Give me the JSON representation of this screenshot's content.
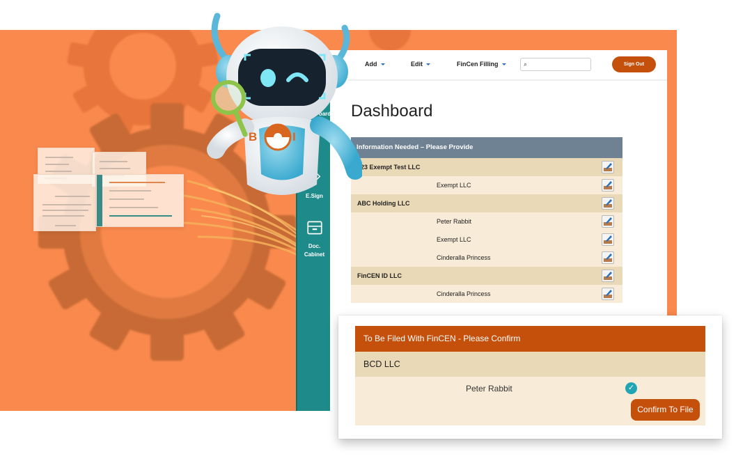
{
  "colors": {
    "backdrop": "#f9894d",
    "teal_sidebar": "#1e8a89",
    "accent_orange": "#c5500c",
    "table_header": "#6f8294",
    "company_row": "#ead9b7",
    "person_row": "#f8ebd7",
    "check_teal": "#21a5b4"
  },
  "robot": {
    "badge_letters": [
      "B",
      "I"
    ],
    "icons": [
      "robot-mascot",
      "magnifier-icon"
    ]
  },
  "nav": {
    "menus": [
      {
        "label": "Add"
      },
      {
        "label": "Edit"
      },
      {
        "label": "FinCen Filling"
      }
    ],
    "search_placeholder": "",
    "sign_out": "Sign Out"
  },
  "sidebar": {
    "items": [
      {
        "label": "oard",
        "icon": "dashboard-icon"
      },
      {
        "label": "E.Sign",
        "icon": "pen-icon"
      },
      {
        "label": "Doc.\nCabinet",
        "label_line1": "Doc.",
        "label_line2": "Cabinet",
        "icon": "cabinet-icon"
      }
    ]
  },
  "main": {
    "title": "Dashboard",
    "info_table": {
      "header": "Information Needed – Please Provide",
      "rows": [
        {
          "type": "company",
          "label": "123 Exempt Test LLC"
        },
        {
          "type": "person",
          "label": "Exempt LLC"
        },
        {
          "type": "company",
          "label": "ABC Holding LLC"
        },
        {
          "type": "person",
          "label": "Peter Rabbit"
        },
        {
          "type": "person",
          "label": "Exempt LLC"
        },
        {
          "type": "person",
          "label": "Cinderalla Princess"
        },
        {
          "type": "company",
          "label": "FinCEN ID LLC"
        },
        {
          "type": "person",
          "label": "Cinderalla Princess"
        }
      ]
    }
  },
  "confirm": {
    "header": "To Be Filed With FinCEN - Please Confirm",
    "company": "BCD LLC",
    "person": "Peter Rabbit",
    "status_icon": "check-circle-icon",
    "button": "Confirm To File"
  }
}
